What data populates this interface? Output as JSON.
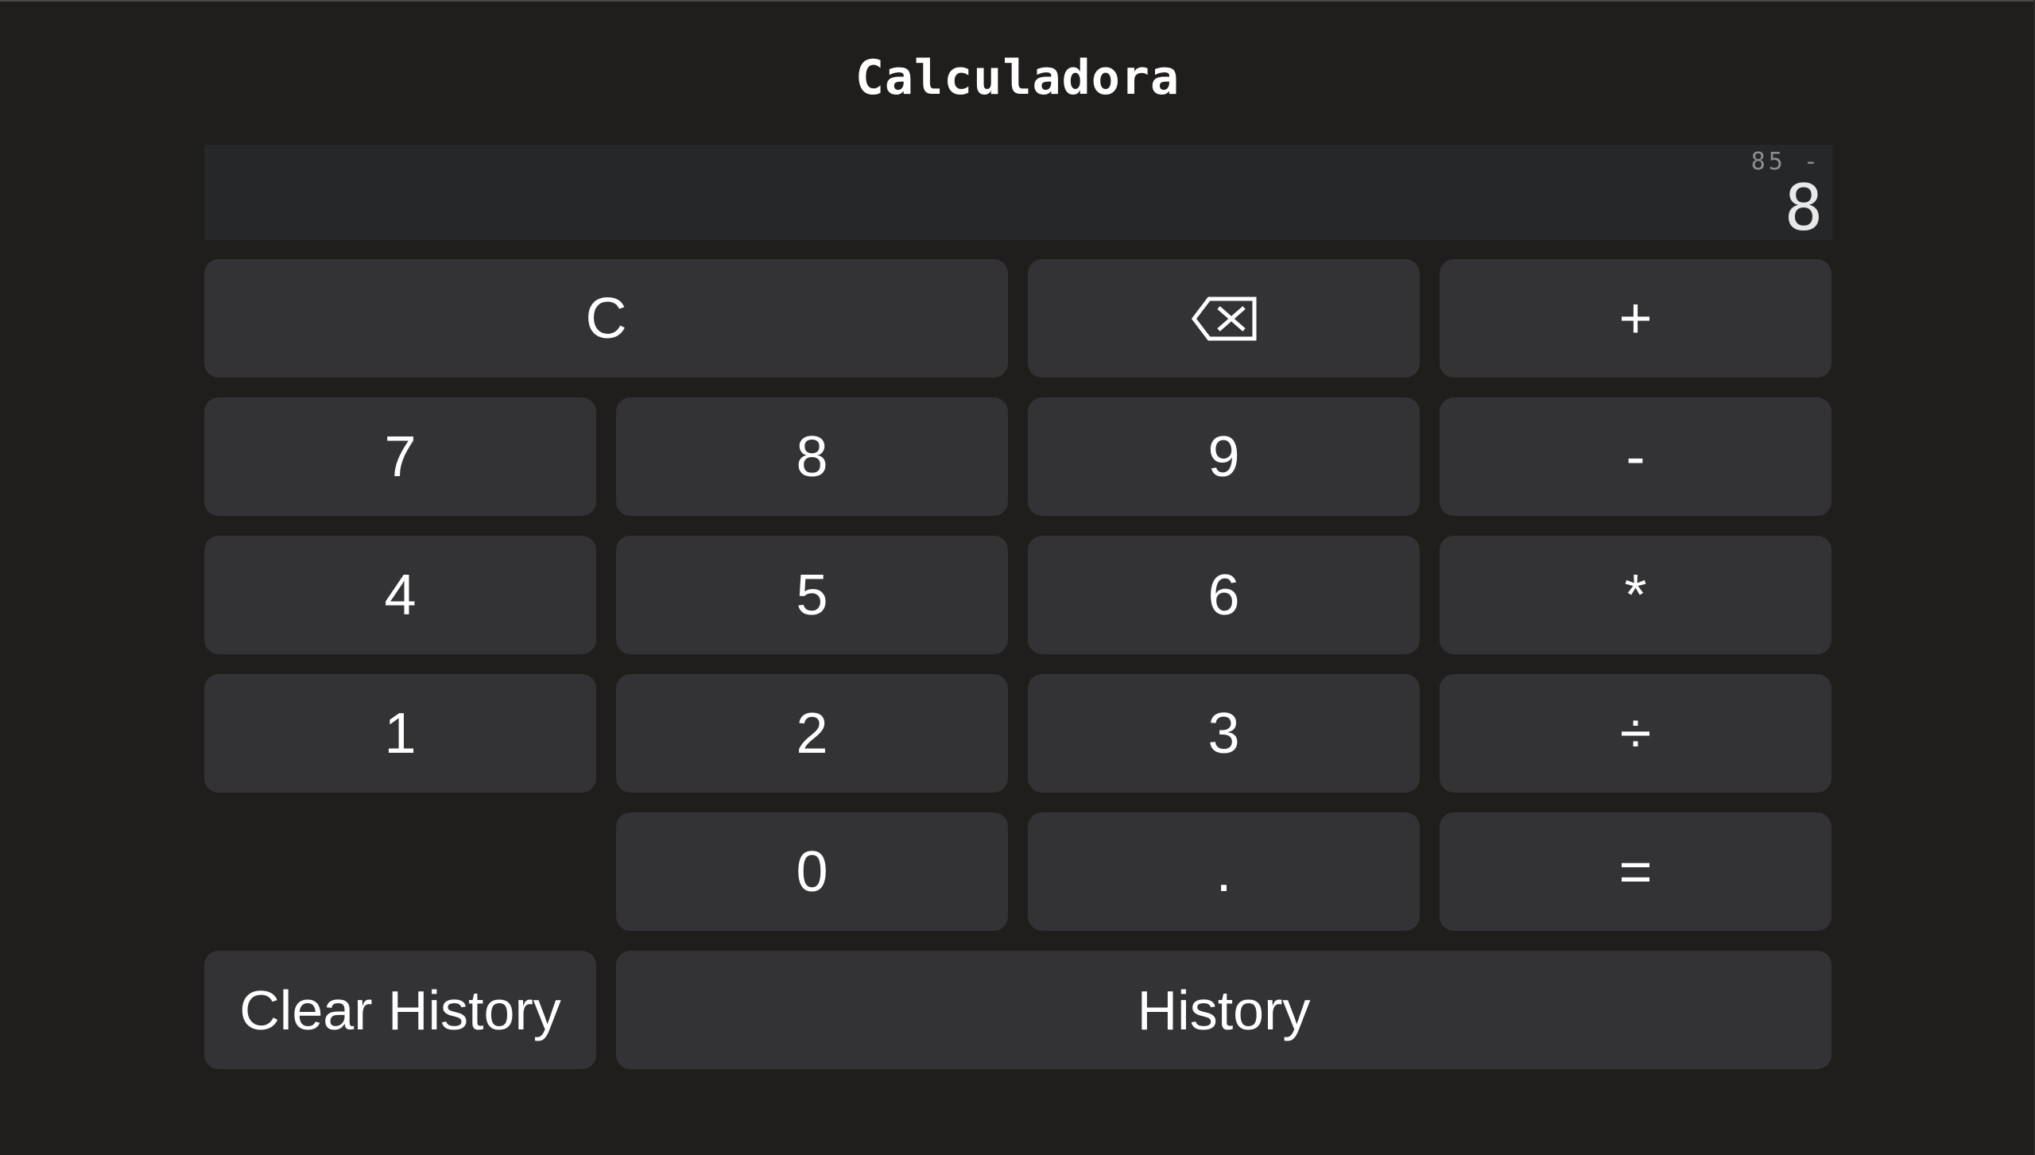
{
  "app": {
    "title": "Calculadora"
  },
  "display": {
    "expression": "85 -",
    "result": "8"
  },
  "keys": {
    "clear": "C",
    "backspace_icon": "backspace-icon",
    "plus": "+",
    "seven": "7",
    "eight": "8",
    "nine": "9",
    "minus": "-",
    "four": "4",
    "five": "5",
    "six": "6",
    "multiply": "*",
    "one": "1",
    "two": "2",
    "three": "3",
    "divide": "÷",
    "zero": "0",
    "decimal": ".",
    "equals": "="
  },
  "history": {
    "clear_label": "Clear History",
    "label": "History"
  },
  "colors": {
    "background": "#201e1d",
    "display_bg": "#262728",
    "key_bg": "#333336",
    "text": "#ffffff"
  }
}
